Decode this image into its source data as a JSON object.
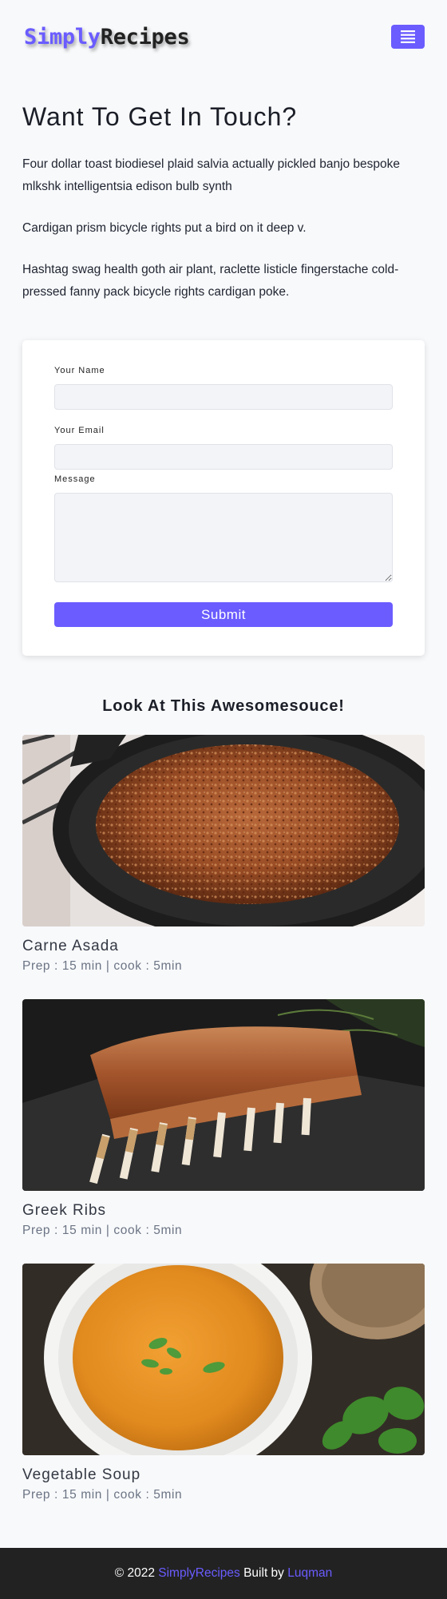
{
  "brand": {
    "first": "Simply",
    "second": "Recipes",
    "accent_color": "#6a5cff"
  },
  "nav": {
    "menu_icon": "hamburger-icon"
  },
  "intro": {
    "title": "Want To Get In Touch?",
    "paragraphs": [
      "Four dollar toast biodiesel plaid salvia actually pickled banjo bespoke mlkshk intelligentsia edison bulb synth",
      "Cardigan prism bicycle rights put a bird on it deep v.",
      "Hashtag swag health goth air plant, raclette listicle fingerstache cold-pressed fanny pack bicycle rights cardigan poke."
    ]
  },
  "form": {
    "name_label": "Your Name",
    "email_label": "Your Email",
    "message_label": "Message",
    "submit_label": "Submit"
  },
  "featured": {
    "title": "Look At This Awesomesouce!",
    "recipes": [
      {
        "name": "Carne Asada",
        "meta": "Prep : 15 min | cook : 5min"
      },
      {
        "name": "Greek Ribs",
        "meta": "Prep : 15 min | cook : 5min"
      },
      {
        "name": "Vegetable Soup",
        "meta": "Prep : 15 min | cook : 5min"
      }
    ]
  },
  "footer": {
    "copyright": "© 2022",
    "brand_link": "SimplyRecipes",
    "built_by": "Built by",
    "author_link": "Luqman"
  }
}
